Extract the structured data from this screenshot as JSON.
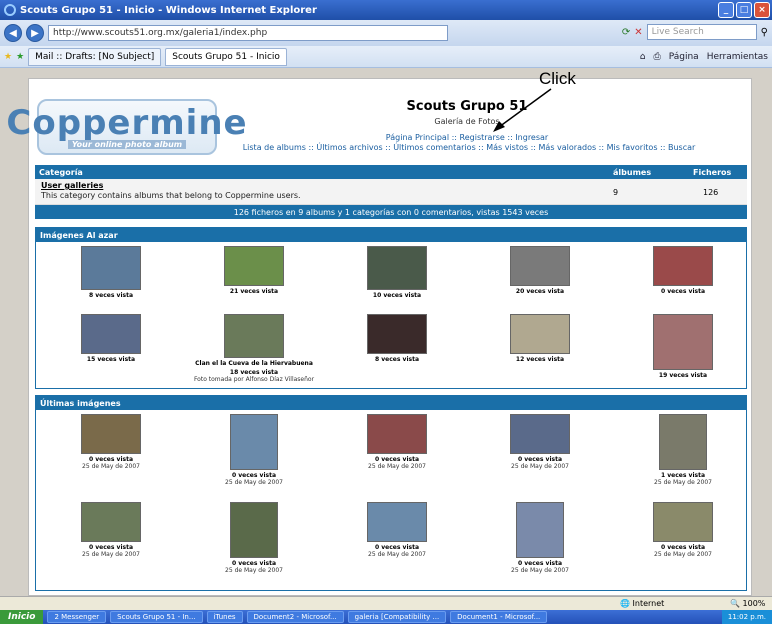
{
  "window": {
    "title": "Scouts Grupo 51 - Inicio - Windows Internet Explorer"
  },
  "address": {
    "url": "http://www.scouts51.org.mx/galeria1/index.php",
    "search_placeholder": "Live Search"
  },
  "tabs": [
    {
      "label": "Mail :: Drafts: [No Subject]"
    },
    {
      "label": "Scouts Grupo 51 - Inicio"
    }
  ],
  "tools": {
    "pagina": "Página",
    "herramientas": "Herramientas"
  },
  "annotation": "Click",
  "logo": {
    "main": "Coppermine",
    "sub": "Your online photo album"
  },
  "site": {
    "title": "Scouts Grupo 51",
    "description": "Galería de Fotos"
  },
  "menu": {
    "line1": "Página Principal :: Registrarse :: Ingresar",
    "line2": "Lista de albums :: Últimos archivos :: Últimos comentarios :: Más vistos :: Más valorados :: Mis favoritos :: Buscar"
  },
  "category_table": {
    "h_cat": "Categoría",
    "h_alb": "álbumes",
    "h_fic": "Ficheros",
    "name": "User galleries",
    "desc": "This category contains albums that belong to Coppermine users.",
    "albums": "9",
    "files": "126",
    "stats": "126 ficheros en 9 albums y 1 categorías con 0 comentarios, vistas 1543 veces"
  },
  "random": {
    "title": "Imágenes Al azar",
    "items": [
      {
        "views": "8 veces vista",
        "color": "#5b7a9a"
      },
      {
        "views": "21 veces vista",
        "color": "#6b8f4a"
      },
      {
        "views": "10 veces vista",
        "color": "#4a5a4a"
      },
      {
        "views": "20 veces vista",
        "color": "#7a7a7a"
      },
      {
        "views": "0 veces vista",
        "color": "#9a4a4a"
      },
      {
        "views": "15 veces vista",
        "color": "#5a6a8a"
      },
      {
        "views": "18 veces vista",
        "title": "Clan el la Cueva de la Hiervabuena",
        "extra": "Foto tomada por Alfonso Díaz Villaseñor",
        "color": "#6a7a5a"
      },
      {
        "views": "8 veces vista",
        "color": "#3a2a2a"
      },
      {
        "views": "12 veces vista",
        "color": "#b0a890"
      },
      {
        "views": "19 veces vista",
        "color": "#a07070"
      }
    ]
  },
  "latest": {
    "title": "Últimas imágenes",
    "items": [
      {
        "views": "0 veces vista",
        "date": "25 de May de 2007",
        "color": "#7a6a4a"
      },
      {
        "views": "0 veces vista",
        "date": "25 de May de 2007",
        "color": "#6a8aaa"
      },
      {
        "views": "0 veces vista",
        "date": "25 de May de 2007",
        "color": "#8a4a4a"
      },
      {
        "views": "0 veces vista",
        "date": "25 de May de 2007",
        "color": "#5a6a8a"
      },
      {
        "views": "1 veces vista",
        "date": "25 de May de 2007",
        "color": "#7a7a6a"
      },
      {
        "views": "0 veces vista",
        "date": "25 de May de 2007",
        "color": "#6a7a5a"
      },
      {
        "views": "0 veces vista",
        "date": "25 de May de 2007",
        "color": "#5a6a4a"
      },
      {
        "views": "0 veces vista",
        "date": "25 de May de 2007",
        "color": "#6a8aaa"
      },
      {
        "views": "0 veces vista",
        "date": "25 de May de 2007",
        "color": "#7a8aaa"
      },
      {
        "views": "0 veces vista",
        "date": "25 de May de 2007",
        "color": "#8a8a6a"
      }
    ]
  },
  "status": {
    "zone": "Internet",
    "zoom": "100%"
  },
  "taskbar": {
    "start": "Inicio",
    "items": [
      "2 Messenger",
      "Scouts Grupo 51 - In...",
      "iTunes",
      "Document2 - Microsof...",
      "galeria [Compatibility ...",
      "Document1 - Microsof..."
    ],
    "clock": "11:02 p.m."
  }
}
